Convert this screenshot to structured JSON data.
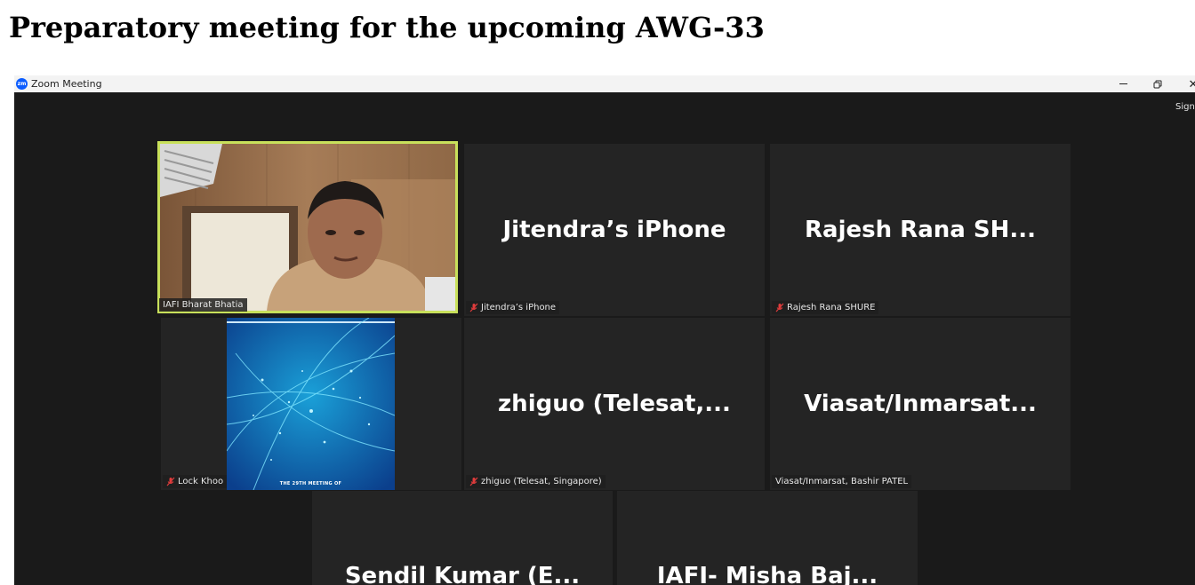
{
  "page": {
    "heading": "Preparatory meeting for the upcoming AWG-33"
  },
  "window": {
    "app_logo_text": "zm",
    "title": "Zoom Meeting",
    "close_glyph": "✕",
    "signin_label": "Sign"
  },
  "colors": {
    "active_speaker": "#c8e05b",
    "tile_background": "#242424",
    "window_background": "#1a1a1a",
    "muted_icon": "#e03c3c"
  },
  "participants": [
    {
      "big_name": "",
      "label": "IAFI Bharat Bhatia",
      "muted": false,
      "video": true,
      "active": true
    },
    {
      "big_name": "Jitendra’s iPhone",
      "label": "Jitendra’s iPhone",
      "muted": true
    },
    {
      "big_name": "Rajesh Rana SH...",
      "label": "Rajesh Rana SHURE",
      "muted": true
    },
    {
      "big_name": "",
      "label": "Lock Khoo",
      "muted": true,
      "avatar_caption": "THE 29TH MEETING OF"
    },
    {
      "big_name": "zhiguo (Telesat,...",
      "label": "zhiguo (Telesat, Singapore)",
      "muted": true
    },
    {
      "big_name": "Viasat/Inmarsat...",
      "label": "Viasat/Inmarsat, Bashir PATEL",
      "muted": false
    },
    {
      "big_name": "Sendil Kumar (E...",
      "label": "",
      "muted": false
    },
    {
      "big_name": "IAFI- Misha Baj...",
      "label": "",
      "muted": false
    }
  ]
}
